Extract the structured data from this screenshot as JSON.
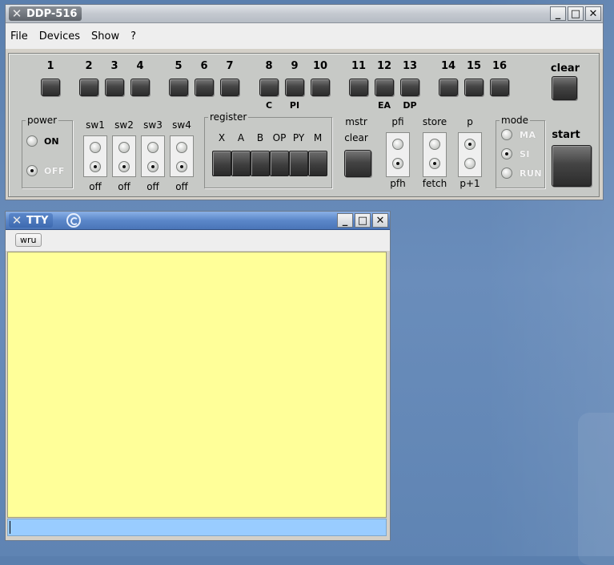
{
  "main_window": {
    "title": "DDP-516",
    "menu": [
      "File",
      "Devices",
      "Show",
      "?"
    ],
    "window_buttons": [
      "_",
      "□",
      "✕"
    ]
  },
  "panel": {
    "sense_keys": [
      "1",
      "2",
      "3",
      "4",
      "5",
      "6",
      "7",
      "8",
      "9",
      "10",
      "11",
      "12",
      "13",
      "14",
      "15",
      "16"
    ],
    "key_sublabels": {
      "8": "C",
      "9": "PI",
      "12": "EA",
      "13": "DP"
    },
    "clear_label": "clear",
    "start_label": "start",
    "power": {
      "legend": "power",
      "on": "ON",
      "off": "OFF",
      "selected": "OFF"
    },
    "sense_switches": [
      {
        "label": "sw1",
        "state": "off"
      },
      {
        "label": "sw2",
        "state": "off"
      },
      {
        "label": "sw3",
        "state": "off"
      },
      {
        "label": "sw4",
        "state": "off"
      }
    ],
    "register": {
      "legend": "register",
      "options": [
        "X",
        "A",
        "B",
        "OP",
        "PY",
        "M"
      ]
    },
    "mstr_clear": {
      "line1": "mstr",
      "line2": "clear"
    },
    "pfi": {
      "top": "pfi",
      "bottom": "pfh",
      "selected": "pfh"
    },
    "store": {
      "top": "store",
      "bottom": "fetch",
      "selected": "fetch"
    },
    "p": {
      "top": "p",
      "bottom": "p+1",
      "selected": "p"
    },
    "mode": {
      "legend": "mode",
      "options": [
        "MA",
        "SI",
        "RUN"
      ],
      "selected": "SI"
    }
  },
  "tty_window": {
    "title": "TTY",
    "window_buttons": [
      "_",
      "□",
      "✕"
    ],
    "wru_button": "wru",
    "output_text": "",
    "input_value": ""
  },
  "colors": {
    "tty_paper": "#ffff99",
    "tty_input": "#99ccff",
    "panel": "#c7c9c6",
    "desktop": "#6a8dbb"
  }
}
